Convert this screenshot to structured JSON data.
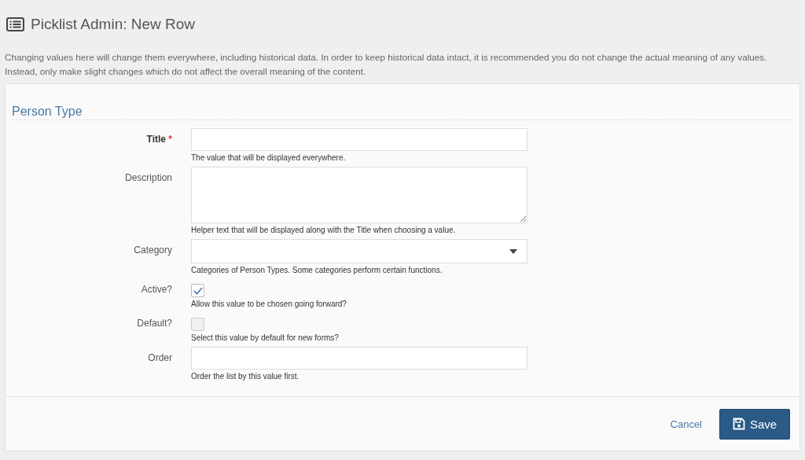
{
  "page": {
    "title": "Picklist Admin: New Row",
    "notice": "Changing values here will change them everywhere, including historical data. In order to keep historical data intact, it is recommended you do not change the actual meaning of any values. Instead, only make slight changes which do not affect the overall meaning of the content."
  },
  "form": {
    "legend": "Person Type",
    "fields": [
      {
        "kind": "text",
        "label": "Title",
        "required": true,
        "required_mark": "*",
        "help": "The value that will be displayed everywhere."
      },
      {
        "kind": "textarea",
        "label": "Description",
        "required": false,
        "help": "Helper text that will be displayed along with the Title when choosing a value."
      },
      {
        "kind": "select",
        "label": "Category",
        "required": false,
        "help": "Categories of Person Types. Some categories perform certain functions."
      },
      {
        "kind": "checkbox",
        "label": "Active?",
        "required": false,
        "checked": true,
        "help": "Allow this value to be chosen going forward?"
      },
      {
        "kind": "checkbox",
        "label": "Default?",
        "required": false,
        "checked": false,
        "help": "Select this value by default for new forms?"
      },
      {
        "kind": "text",
        "label": "Order",
        "required": false,
        "help": "Order the list by this value first."
      }
    ]
  },
  "buttons": {
    "cancel": "Cancel",
    "save": "Save"
  }
}
